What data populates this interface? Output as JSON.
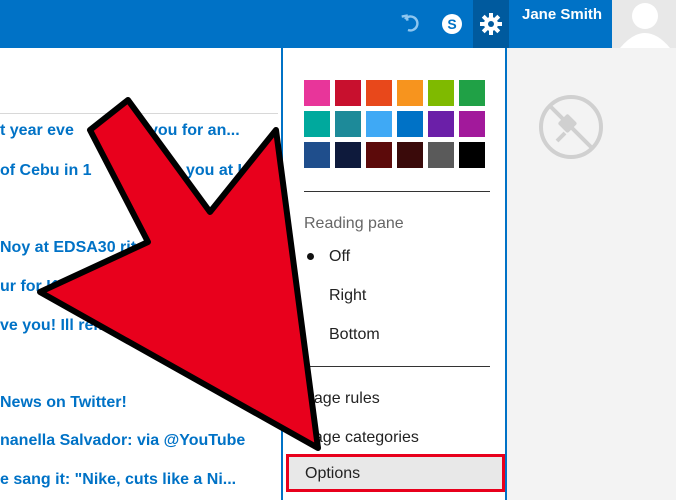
{
  "header": {
    "username": "Jane Smith",
    "icons": [
      "undo-icon",
      "skype-icon",
      "gear-icon",
      "avatar-icon"
    ],
    "bar_color": "#0072c6"
  },
  "messages": [
    "t year eve",
    "you for an...",
    "of Cebu in 1",
    "you at U",
    "Noy at EDSA30 rit",
    "ur for K",
    "ve you! Ill reme",
    "News on Twitter!",
    "nanella Salvador: via @YouTube",
    "e sang it: \"Nike, cuts like a Ni..."
  ],
  "settings_panel": {
    "theme_colors": [
      "#e8359a",
      "#c8102e",
      "#e8481b",
      "#f7941e",
      "#7fba00",
      "#20a146",
      "#00a99d",
      "#1d8a99",
      "#3fa9f5",
      "#0072c6",
      "#6b1fa8",
      "#a2199b",
      "#1f4e8c",
      "#0e1a3c",
      "#5c0a0a",
      "#3a0a0a",
      "#5a5a5a",
      "#000000"
    ],
    "reading_pane": {
      "title": "Reading pane",
      "options": [
        "Off",
        "Right",
        "Bottom"
      ],
      "selected": "Off"
    },
    "menu": [
      "nage rules",
      "nage categories",
      "Options"
    ]
  },
  "reading_area": {
    "icon": "no-plugin-icon"
  },
  "annotation": {
    "arrow_color": "#e8001c"
  }
}
